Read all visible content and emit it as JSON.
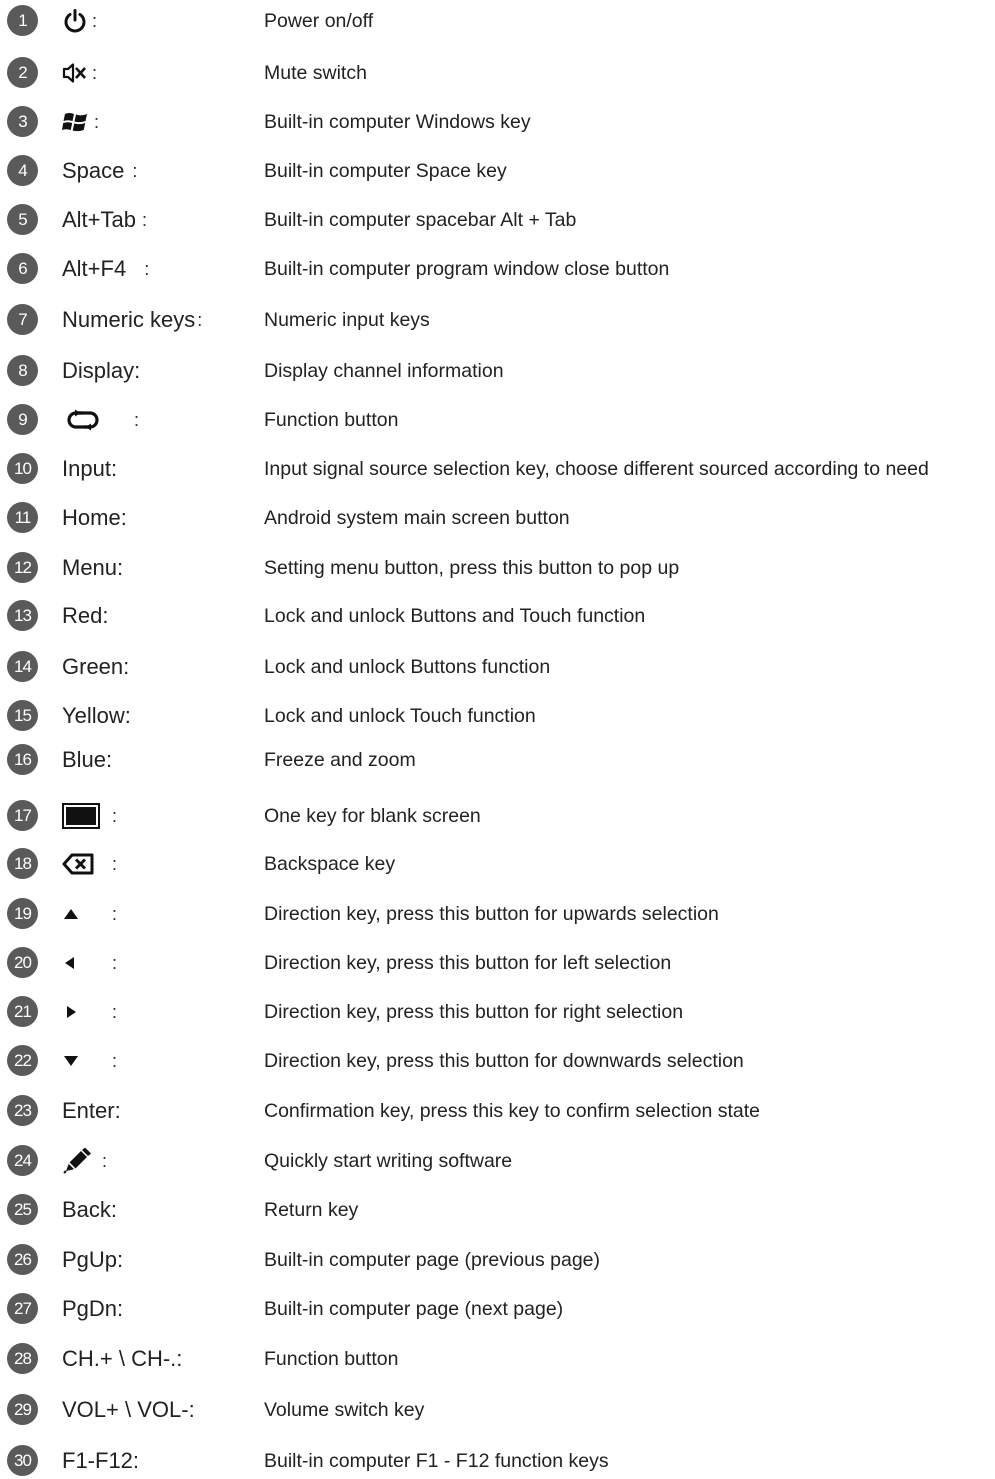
{
  "separator": ":",
  "rows": [
    {
      "n": "1",
      "icon": "power-icon",
      "label": "",
      "desc": "Power on/off"
    },
    {
      "n": "2",
      "icon": "mute-icon",
      "label": "",
      "desc": "Mute switch"
    },
    {
      "n": "3",
      "icon": "windows-icon",
      "label": "",
      "desc": "Built-in computer Windows key"
    },
    {
      "n": "4",
      "icon": "",
      "label": "Space",
      "desc": "Built-in computer Space key"
    },
    {
      "n": "5",
      "icon": "",
      "label": "Alt+Tab",
      "desc": "Built-in computer spacebar Alt + Tab"
    },
    {
      "n": "6",
      "icon": "",
      "label": "Alt+F4",
      "desc": "Built-in computer program window close button"
    },
    {
      "n": "7",
      "icon": "",
      "label": "Numeric keys",
      "desc": "Numeric input keys"
    },
    {
      "n": "8",
      "icon": "",
      "label": "Display",
      "desc": "Display channel information"
    },
    {
      "n": "9",
      "icon": "loop-icon",
      "label": "",
      "desc": "Function button"
    },
    {
      "n": "10",
      "icon": "",
      "label": "Input",
      "desc": "Input signal source selection key, choose different sourced according to need"
    },
    {
      "n": "11",
      "icon": "",
      "label": "Home",
      "desc": "Android system main screen button"
    },
    {
      "n": "12",
      "icon": "",
      "label": "Menu",
      "desc": "Setting menu button, press this button to pop up"
    },
    {
      "n": "13",
      "icon": "",
      "label": "Red",
      "desc": "Lock and unlock Buttons and Touch function"
    },
    {
      "n": "14",
      "icon": "",
      "label": "Green",
      "desc": "Lock and unlock Buttons function"
    },
    {
      "n": "15",
      "icon": "",
      "label": "Yellow",
      "desc": "Lock and unlock Touch function"
    },
    {
      "n": "16",
      "icon": "",
      "label": "Blue",
      "desc": "Freeze and zoom"
    },
    {
      "n": "17",
      "icon": "blank-screen-icon",
      "label": "",
      "desc": "One key for blank screen"
    },
    {
      "n": "18",
      "icon": "backspace-icon",
      "label": "",
      "desc": "Backspace key"
    },
    {
      "n": "19",
      "icon": "arrow-up-icon",
      "label": "",
      "desc": "Direction key, press this button for upwards selection"
    },
    {
      "n": "20",
      "icon": "arrow-left-icon",
      "label": "",
      "desc": "Direction key, press this button for left selection"
    },
    {
      "n": "21",
      "icon": "arrow-right-icon",
      "label": "",
      "desc": "Direction key, press this button for right selection"
    },
    {
      "n": "22",
      "icon": "arrow-down-icon",
      "label": "",
      "desc": "Direction key, press this button for downwards selection"
    },
    {
      "n": "23",
      "icon": "",
      "label": "Enter",
      "desc": "Confirmation key, press this key to confirm selection state"
    },
    {
      "n": "24",
      "icon": "pen-icon",
      "label": "",
      "desc": "Quickly start writing software"
    },
    {
      "n": "25",
      "icon": "",
      "label": "Back",
      "desc": "Return key"
    },
    {
      "n": "26",
      "icon": "",
      "label": "PgUp",
      "desc": "Built-in computer page (previous page)"
    },
    {
      "n": "27",
      "icon": "",
      "label": "PgDn",
      "desc": "Built-in computer page (next page)"
    },
    {
      "n": "28",
      "icon": "",
      "label": "CH.+ \\ CH-.",
      "desc": "Function button"
    },
    {
      "n": "29",
      "icon": "",
      "label": "VOL+ \\ VOL-",
      "desc": "Volume switch key"
    },
    {
      "n": "30",
      "icon": "",
      "label": "F1-F12",
      "desc": "Built-in computer F1 - F12 function keys"
    }
  ]
}
